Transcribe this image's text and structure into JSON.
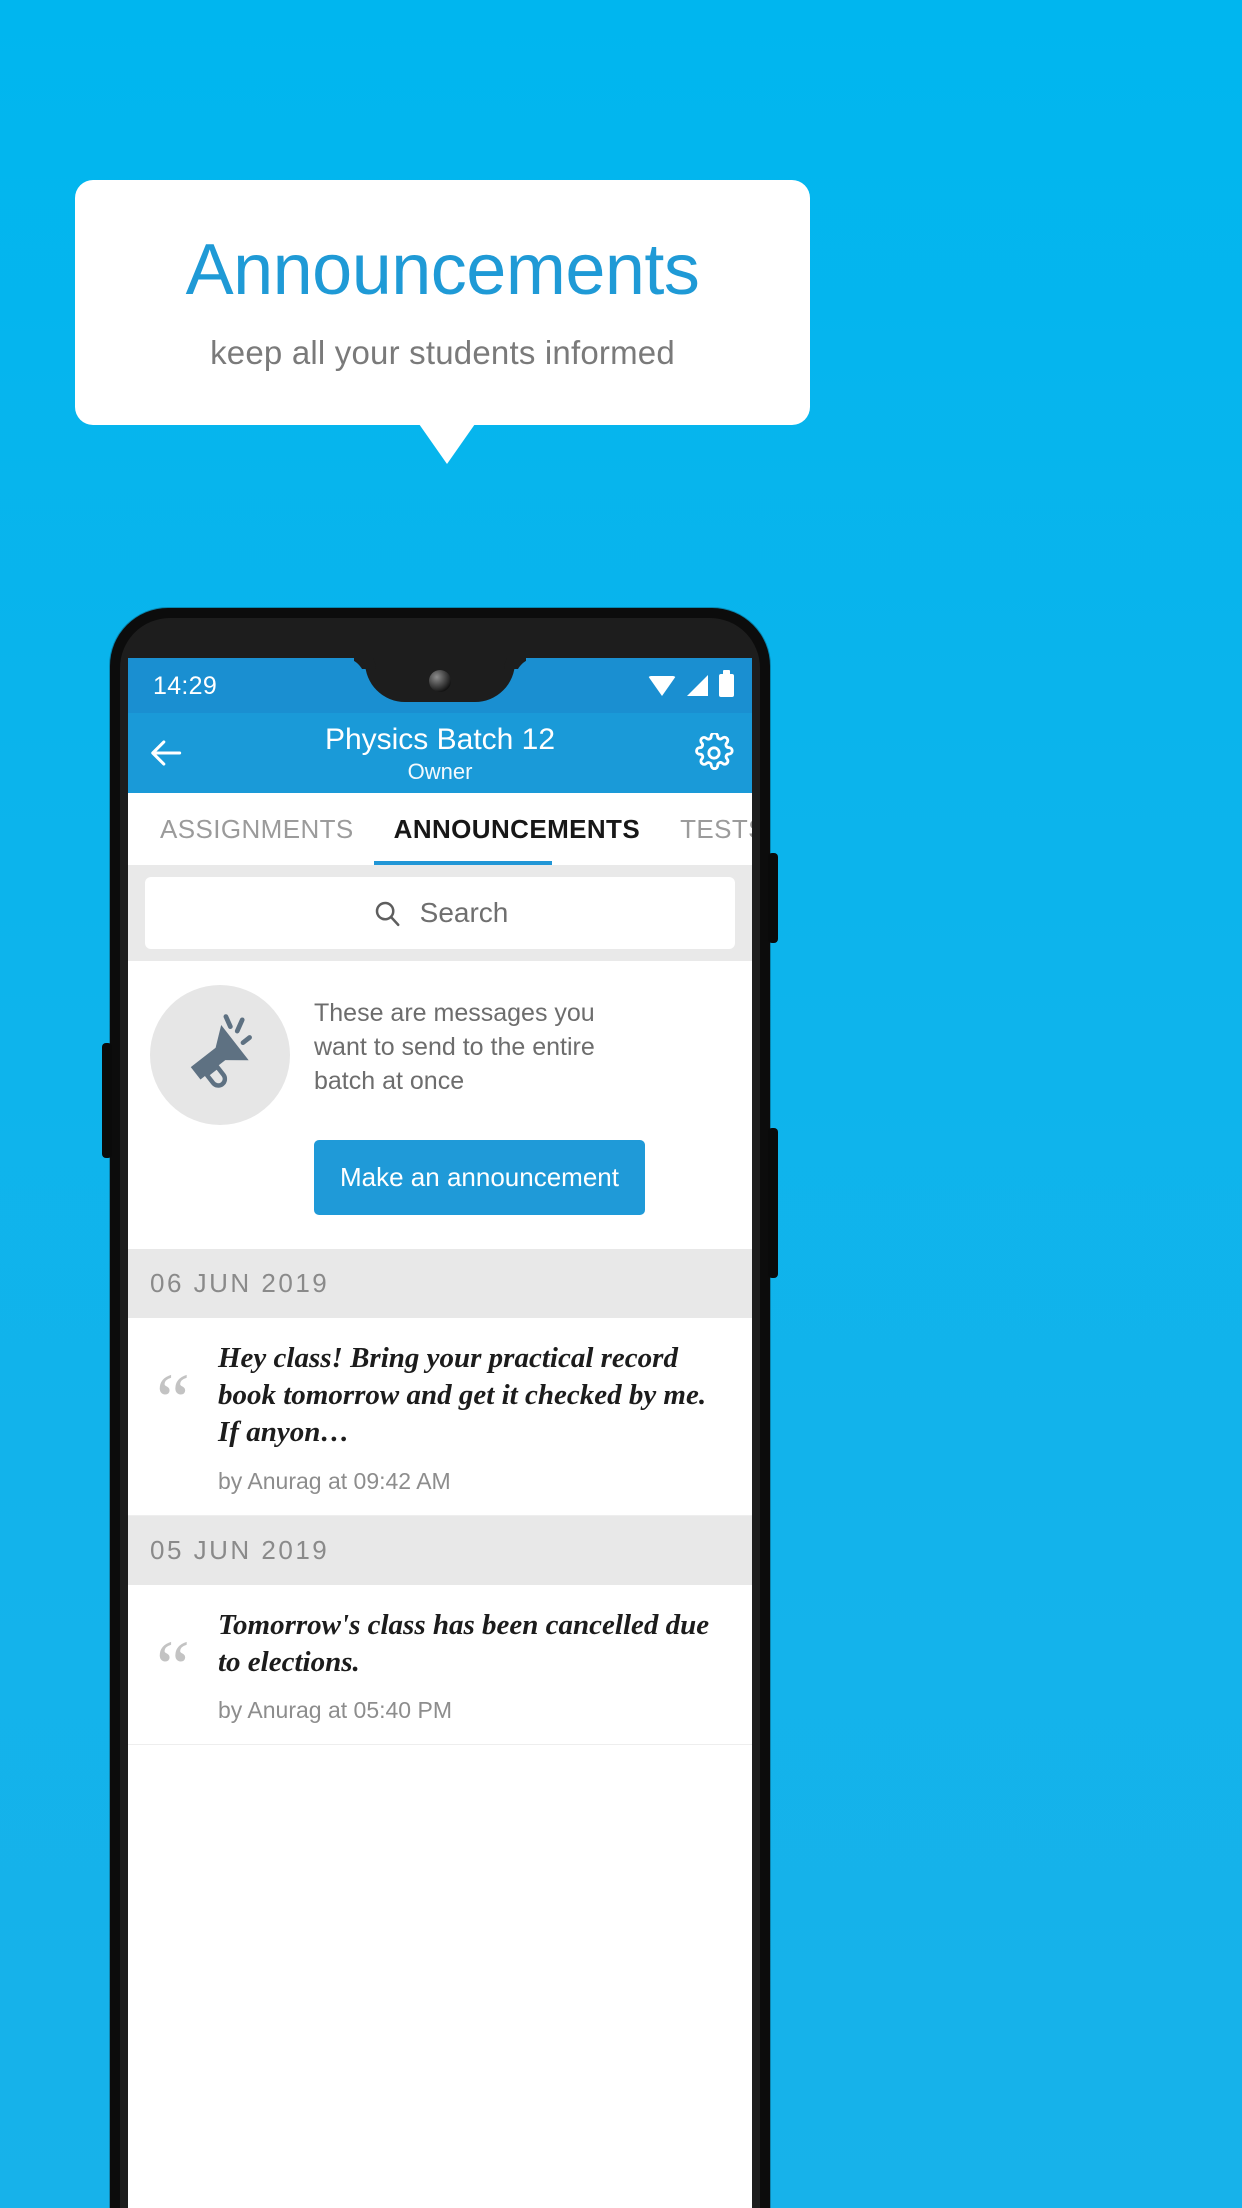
{
  "callout": {
    "title": "Announcements",
    "subtitle": "keep all your students informed",
    "title_color": "#1f9ad6",
    "background": "#ffffff"
  },
  "background_color": "#0fb4ec",
  "phone": {
    "status_bar": {
      "time": "14:29",
      "icons": [
        "wifi-icon",
        "signal-icon",
        "battery-icon"
      ],
      "background": "#1a8fd1"
    },
    "app_bar": {
      "back_icon": "back-arrow-icon",
      "title": "Physics Batch 12",
      "subtitle": "Owner",
      "settings_icon": "gear-icon",
      "background": "#1a9ad8"
    },
    "tabs": {
      "items": [
        {
          "label": "ASSIGNMENTS",
          "active": false
        },
        {
          "label": "ANNOUNCEMENTS",
          "active": true
        },
        {
          "label": "TESTS",
          "active": false
        },
        {
          "label": "",
          "active": false
        }
      ],
      "active_index": 1,
      "indicator_color": "#2196d6"
    },
    "search": {
      "icon": "search-icon",
      "placeholder": "Search",
      "value": ""
    },
    "promo": {
      "icon": "megaphone-icon",
      "text": "These are messages you want to send to the entire batch at once",
      "button_label": "Make an announcement",
      "button_color": "#1f9ad8"
    },
    "groups": [
      {
        "date": "06  JUN  2019",
        "items": [
          {
            "quote_icon": "quote-icon",
            "text": "Hey class! Bring your practical record book tomorrow and get it checked by me. If anyon…",
            "meta": "by Anurag at 09:42 AM"
          }
        ]
      },
      {
        "date": "05  JUN  2019",
        "items": [
          {
            "quote_icon": "quote-icon",
            "text": "Tomorrow's class has been cancelled due to elections.",
            "meta": "by Anurag at 05:40 PM"
          }
        ]
      }
    ]
  }
}
